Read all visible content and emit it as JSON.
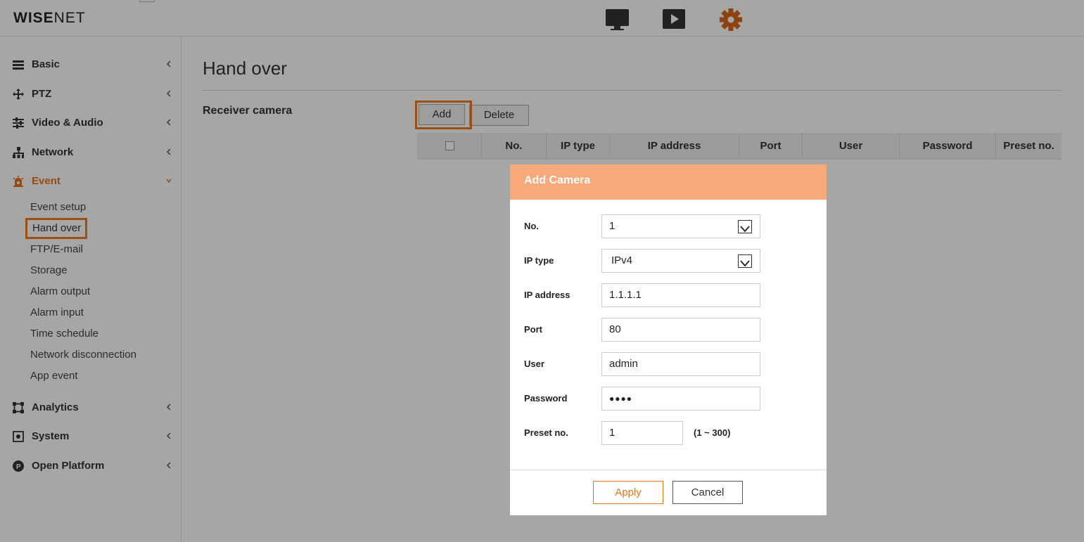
{
  "app": {
    "logo_bold": "WISE",
    "logo_light": "NET",
    "top_icons": [
      "monitor-icon",
      "play-icon",
      "gear-icon"
    ],
    "accent_color": "#e5731d",
    "header_color": "#f7a97a"
  },
  "sidebar": {
    "items": [
      {
        "label": "Basic",
        "icon": "list-icon"
      },
      {
        "label": "PTZ",
        "icon": "move-arrows-icon"
      },
      {
        "label": "Video & Audio",
        "icon": "sliders-icon"
      },
      {
        "label": "Network",
        "icon": "network-icon"
      },
      {
        "label": "Event",
        "icon": "alarm-bell-icon"
      },
      {
        "label": "Analytics",
        "icon": "frame-icon"
      },
      {
        "label": "System",
        "icon": "system-icon"
      },
      {
        "label": "Open Platform",
        "icon": "platform-icon"
      }
    ],
    "event_subitems": [
      "Event setup",
      "Hand over",
      "FTP/E-mail",
      "Storage",
      "Alarm output",
      "Alarm input",
      "Time schedule",
      "Network disconnection",
      "App event"
    ],
    "selected_subitem": "Hand over"
  },
  "main": {
    "title": "Hand over",
    "section_label": "Receiver camera",
    "add_label": "Add",
    "delete_label": "Delete",
    "table_columns": [
      "No.",
      "IP type",
      "IP address",
      "Port",
      "User",
      "Password",
      "Preset no."
    ]
  },
  "dialog": {
    "title": "Add Camera",
    "fields": [
      {
        "label": "No.",
        "value": "1",
        "type": "select"
      },
      {
        "label": "IP type",
        "value": "IPv4",
        "type": "select"
      },
      {
        "label": "IP address",
        "value": "1.1.1.1",
        "type": "text"
      },
      {
        "label": "Port",
        "value": "80",
        "type": "text"
      },
      {
        "label": "User",
        "value": "admin",
        "type": "text"
      },
      {
        "label": "Password",
        "value": "●●●●",
        "type": "password"
      },
      {
        "label": "Preset no.",
        "value": "1",
        "type": "text"
      }
    ],
    "preset_range": "(1 ~ 300)",
    "apply_label": "Apply",
    "cancel_label": "Cancel"
  }
}
